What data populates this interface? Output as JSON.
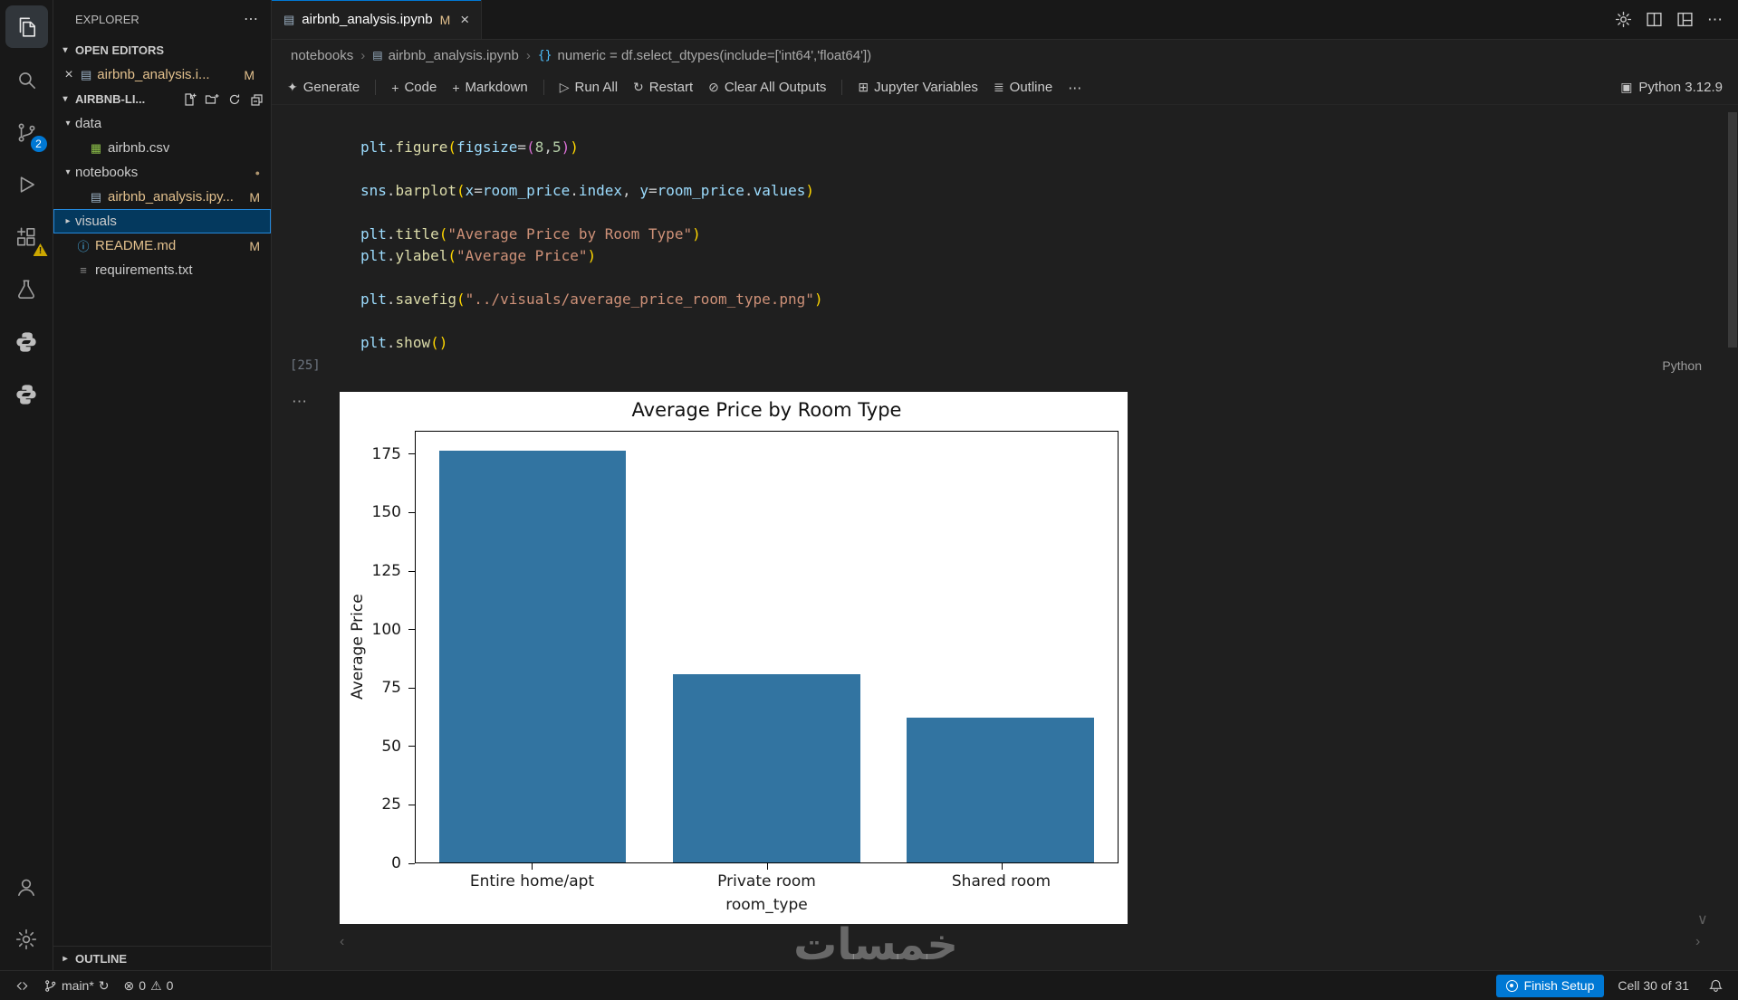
{
  "window": {
    "watermark": "خمسات"
  },
  "icons": {
    "chevron_down": "▾",
    "chevron_right": "▸",
    "chevron_left_small": "‹",
    "chevron_right_small": "›",
    "chevron_down_small": "∨",
    "close": "×",
    "ellipsis": "⋯",
    "breadcrumb_separator": "›",
    "plus": "+",
    "generate_sparkle": "✦",
    "run_all": "▷",
    "restart": "↻",
    "clear_outputs": "⊘",
    "jupyter_variables": "⊞",
    "outline_list": "≣",
    "kernel_box": "▣",
    "error_circle": "⊗",
    "warning_triangle": "⚠",
    "sync": "↻",
    "modified_dot": "●",
    "csv_file": "▦",
    "notebook_file": "▤",
    "info_file": "ⓘ",
    "text_file": "≡",
    "symbol_braces": "{}"
  },
  "activity_bar": {
    "scm_badge": "2"
  },
  "sidebar": {
    "title": "EXPLORER",
    "sections": {
      "open_editors": "OPEN EDITORS",
      "workspace": "AIRBNB-LI...",
      "outline": "OUTLINE"
    },
    "open_editor": {
      "name": "airbnb_analysis.i...",
      "badge": "M"
    },
    "tree": [
      {
        "label": "data",
        "kind": "folder",
        "expanded": true,
        "indent": 0
      },
      {
        "label": "airbnb.csv",
        "kind": "csv",
        "indent": 1
      },
      {
        "label": "notebooks",
        "kind": "folder",
        "expanded": true,
        "indent": 0,
        "dot": true
      },
      {
        "label": "airbnb_analysis.ipy...",
        "kind": "notebook",
        "indent": 1,
        "badge": "M"
      },
      {
        "label": "visuals",
        "kind": "folder",
        "expanded": false,
        "indent": 0,
        "selected": true
      },
      {
        "label": "README.md",
        "kind": "info",
        "indent": 0,
        "badge": "M"
      },
      {
        "label": "requirements.txt",
        "kind": "text",
        "indent": 0
      }
    ]
  },
  "editor": {
    "tab": {
      "title": "airbnb_analysis.ipynb",
      "git_badge": "M"
    },
    "breadcrumbs": [
      "notebooks",
      "airbnb_analysis.ipynb",
      "numeric = df.select_dtypes(include=['int64','float64'])"
    ],
    "toolbar": {
      "generate": "Generate",
      "code": "Code",
      "markdown": "Markdown",
      "run_all": "Run All",
      "restart": "Restart",
      "clear_outputs": "Clear All Outputs",
      "variables": "Jupyter Variables",
      "outline": "Outline",
      "kernel": "Python 3.12.9"
    },
    "cell": {
      "execution_count": "[25]",
      "language": "Python",
      "code": [
        [
          [
            "v",
            "plt"
          ],
          [
            "p",
            "."
          ],
          [
            "f",
            "figure"
          ],
          [
            "b1",
            "("
          ],
          [
            "v",
            "figsize"
          ],
          [
            "p",
            "="
          ],
          [
            "b2",
            "("
          ],
          [
            "n",
            "8"
          ],
          [
            "p",
            ","
          ],
          [
            "n",
            "5"
          ],
          [
            "b2",
            ")"
          ],
          [
            "b1",
            ")"
          ]
        ],
        [],
        [
          [
            "v",
            "sns"
          ],
          [
            "p",
            "."
          ],
          [
            "f",
            "barplot"
          ],
          [
            "b1",
            "("
          ],
          [
            "v",
            "x"
          ],
          [
            "p",
            "="
          ],
          [
            "v",
            "room_price"
          ],
          [
            "p",
            "."
          ],
          [
            "v",
            "index"
          ],
          [
            "p",
            ", "
          ],
          [
            "v",
            "y"
          ],
          [
            "p",
            "="
          ],
          [
            "v",
            "room_price"
          ],
          [
            "p",
            "."
          ],
          [
            "v",
            "values"
          ],
          [
            "b1",
            ")"
          ]
        ],
        [],
        [
          [
            "v",
            "plt"
          ],
          [
            "p",
            "."
          ],
          [
            "f",
            "title"
          ],
          [
            "b1",
            "("
          ],
          [
            "s",
            "\"Average Price by Room Type\""
          ],
          [
            "b1",
            ")"
          ]
        ],
        [
          [
            "v",
            "plt"
          ],
          [
            "p",
            "."
          ],
          [
            "f",
            "ylabel"
          ],
          [
            "b1",
            "("
          ],
          [
            "s",
            "\"Average Price\""
          ],
          [
            "b1",
            ")"
          ]
        ],
        [],
        [
          [
            "v",
            "plt"
          ],
          [
            "p",
            "."
          ],
          [
            "f",
            "savefig"
          ],
          [
            "b1",
            "("
          ],
          [
            "s",
            "\"../visuals/average_price_room_type.png\""
          ],
          [
            "b1",
            ")"
          ]
        ],
        [],
        [
          [
            "v",
            "plt"
          ],
          [
            "p",
            "."
          ],
          [
            "f",
            "show"
          ],
          [
            "b1",
            "("
          ],
          [
            "b1",
            ")"
          ]
        ]
      ]
    }
  },
  "chart_data": {
    "type": "bar",
    "title": "Average Price by Room Type",
    "xlabel": "room_type",
    "ylabel": "Average Price",
    "categories": [
      "Entire home/apt",
      "Private room",
      "Shared room"
    ],
    "values": [
      177,
      81,
      62
    ],
    "ylim": [
      0,
      185
    ],
    "yticks": [
      0,
      25,
      50,
      75,
      100,
      125,
      150,
      175
    ],
    "bar_color": "#3274a1",
    "grid": false,
    "legend": null,
    "background": "#ffffff"
  },
  "status_bar": {
    "branch": "main*",
    "errors": "0",
    "warnings": "0",
    "finish_setup": "Finish Setup",
    "cell_position": "Cell 30 of 31"
  }
}
